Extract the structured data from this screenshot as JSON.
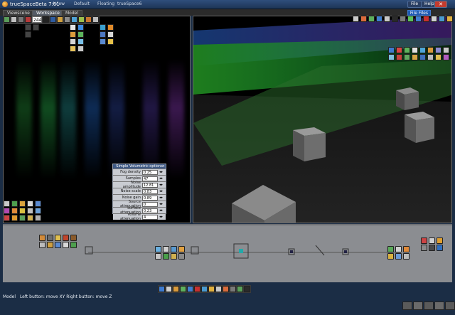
{
  "window": {
    "title": "trueSpaceBeta 7.61",
    "close": "✕",
    "minimize": "–",
    "maximize": "□"
  },
  "menus": [
    {
      "label": "4View"
    },
    {
      "label": "Default"
    },
    {
      "label": "Floating"
    },
    {
      "label": "trueSpace6"
    }
  ],
  "header_buttons": {
    "file": "File",
    "help": "Help",
    "file_files": "File Files"
  },
  "tabs": [
    {
      "label": "Viewscene",
      "active": false
    },
    {
      "label": "Workspace",
      "active": true
    },
    {
      "label": "Model",
      "active": false
    }
  ],
  "frame": {
    "value": "244"
  },
  "panel": {
    "title": "Simple Volumetric options",
    "rows": [
      {
        "label": "Fog density",
        "value": "0.25"
      },
      {
        "label": "Samples",
        "value": "47"
      },
      {
        "label": "Noise amplitude",
        "value": "12.81"
      },
      {
        "label": "Noise scale",
        "value": "0.83"
      },
      {
        "label": "Noise gain",
        "value": "0.89"
      },
      {
        "label": "Source attenuation",
        "value": "0"
      },
      {
        "label": "Surface attenuation",
        "value": "0.23"
      },
      {
        "label": "Volume attenuation",
        "value": "4"
      }
    ]
  },
  "status": {
    "mode": "Model",
    "hint": "Left button: move XY  Right button: move Z"
  },
  "colors": {
    "red": "#c73030",
    "green": "#3f9b3f",
    "blue": "#2e69c9",
    "beam_green": "#2fd83a",
    "beam_blue": "#2a7fff",
    "beam_purple": "#9c4dff"
  }
}
